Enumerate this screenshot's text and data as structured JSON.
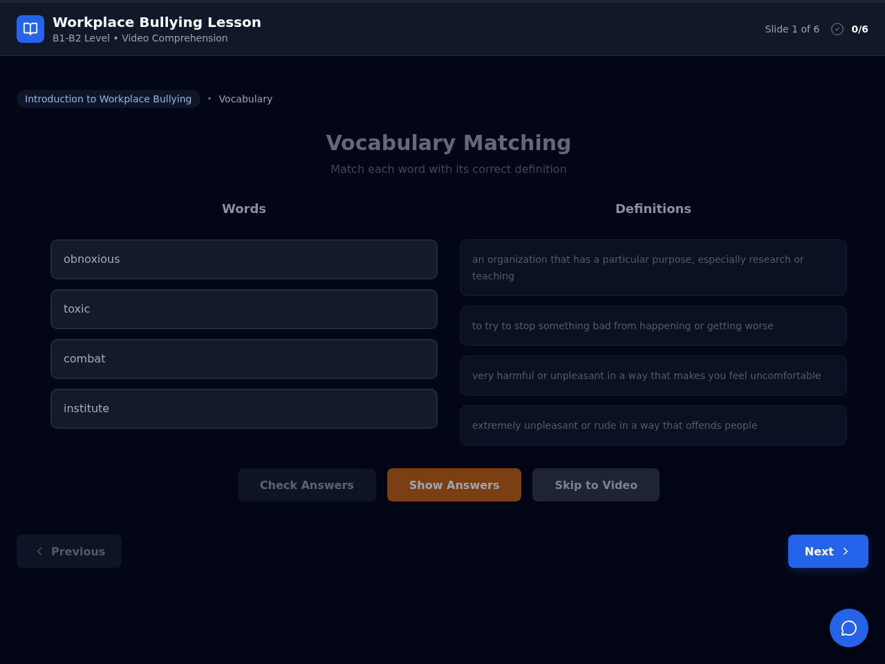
{
  "header": {
    "title": "Workplace Bullying Lesson",
    "subtitle": "B1-B2 Level • Video Comprehension",
    "slide_counter": "Slide 1 of 6",
    "score": "0/6"
  },
  "breadcrumb": {
    "section": "Introduction to Workplace Bullying",
    "separator": "•",
    "current": "Vocabulary"
  },
  "exercise": {
    "title": "Vocabulary Matching",
    "instructions": "Match each word with its correct definition",
    "words_heading": "Words",
    "definitions_heading": "Definitions",
    "words": [
      "obnoxious",
      "toxic",
      "combat",
      "institute"
    ],
    "definitions": [
      "an organization that has a particular purpose, especially research or teaching",
      "to try to stop something bad from happening or getting worse",
      "very harmful or unpleasant in a way that makes you feel uncomfortable",
      "extremely unpleasant or rude in a way that offends people"
    ]
  },
  "actions": [
    {
      "kind": "check",
      "label": "Check Answers",
      "disabled": true
    },
    {
      "kind": "show",
      "label": "Show Answers",
      "disabled": false
    },
    {
      "kind": "skip",
      "label": "Skip to Video",
      "disabled": false
    }
  ],
  "navigation": [
    {
      "kind": "previous",
      "label": "Previous",
      "disabled": true
    },
    {
      "kind": "next",
      "label": "Next",
      "disabled": false
    }
  ]
}
